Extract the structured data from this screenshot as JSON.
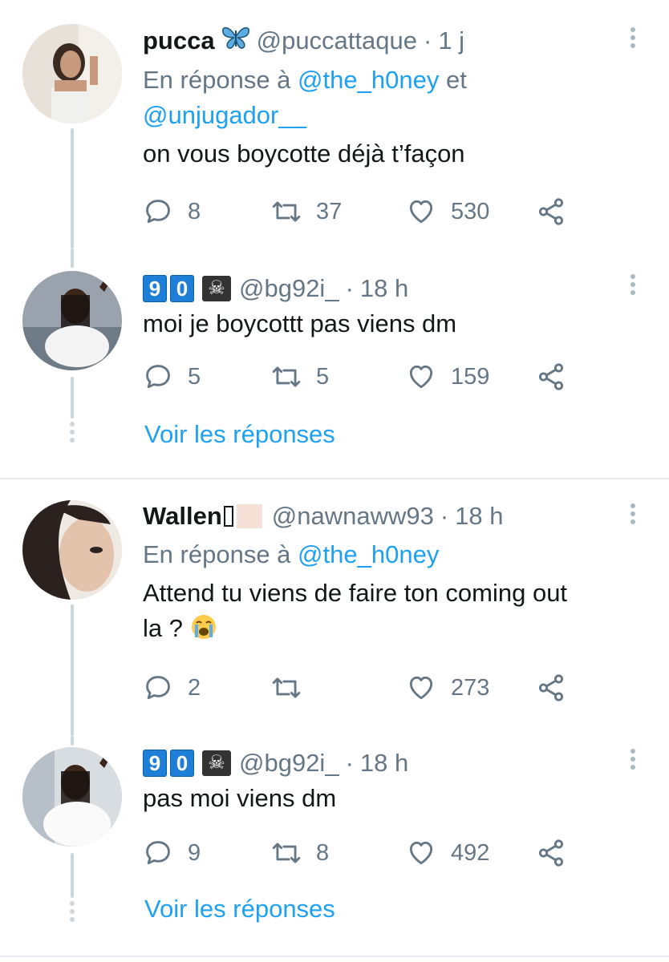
{
  "threads": [
    {
      "tweets": [
        {
          "name": "pucca",
          "handle": "@puccattaque",
          "time": "1 j",
          "reply_prefix": "En réponse à",
          "mentions_line1": "@the_h0ney",
          "reply_and": "et",
          "mentions_line2": "@unjugador__",
          "text": "on vous boycotte déjà t’façon",
          "replies": "8",
          "retweets": "37",
          "likes": "530"
        },
        {
          "badge_digits": [
            "9",
            "0"
          ],
          "handle": "@bg92i_",
          "time": "18 h",
          "text": "moi je boycottt pas viens dm",
          "replies": "5",
          "retweets": "5",
          "likes": "159"
        }
      ],
      "see_replies": "Voir les réponses"
    },
    {
      "tweets": [
        {
          "name": "Wallen",
          "handle": "@nawnaww93",
          "time": "18 h",
          "reply_prefix": "En réponse à",
          "mentions_line1": "@the_h0ney",
          "text_line1": "Attend tu viens de faire ton coming out",
          "text_line2": "la ?",
          "replies": "2",
          "retweets": "",
          "likes": "273"
        },
        {
          "badge_digits": [
            "9",
            "0"
          ],
          "handle": "@bg92i_",
          "time": "18 h",
          "text": "pas moi viens dm",
          "replies": "9",
          "retweets": "8",
          "likes": "492"
        }
      ],
      "see_replies": "Voir les réponses"
    }
  ],
  "separator": "·",
  "icons": {
    "reply": "speech-bubble-icon",
    "retweet": "retweet-icon",
    "like": "heart-icon",
    "share": "share-icon",
    "more": "more-vertical-icon",
    "verified_emoji": "butterfly-emoji",
    "pirate_flag": "pirate-flag-emoji",
    "crying": "loudly-crying-face-emoji"
  },
  "colors": {
    "accent": "#1da1f2",
    "secondary_text": "#657786",
    "line": "#ccd6dd"
  }
}
